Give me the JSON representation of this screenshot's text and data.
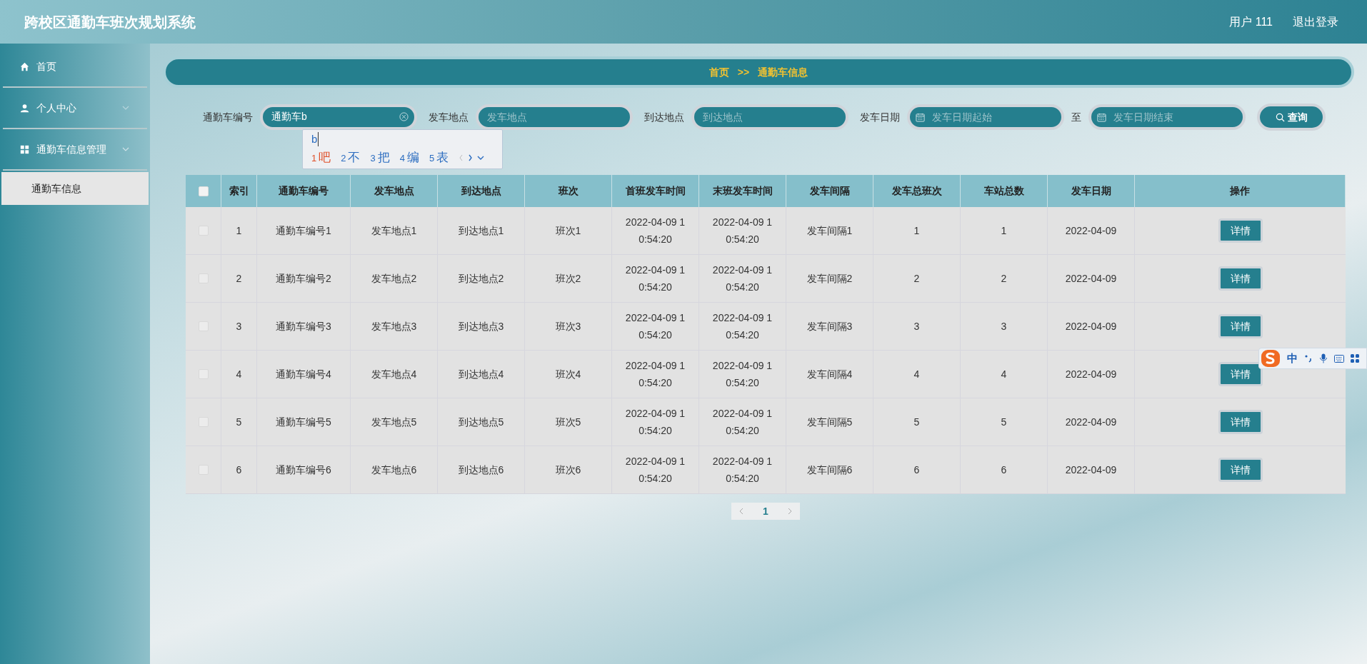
{
  "header": {
    "title": "跨校区通勤车班次规划系统",
    "user": "用户 111",
    "logout": "退出登录"
  },
  "sidebar": {
    "items": [
      {
        "label": "首页",
        "selected": false
      },
      {
        "label": "个人中心",
        "selected": false,
        "expanded": false
      },
      {
        "label": "通勤车信息管理",
        "selected": false,
        "expanded": true,
        "children": [
          {
            "label": "通勤车信息",
            "selected": true
          }
        ]
      }
    ]
  },
  "breadcrumb": {
    "home": "首页",
    "separator": ">>",
    "current": "通勤车信息"
  },
  "search": {
    "fields": [
      {
        "label": "通勤车编号",
        "value": "通勤车b",
        "clearable": true
      },
      {
        "label": "发车地点",
        "placeholder": "发车地点"
      },
      {
        "label": "到达地点",
        "placeholder": "到达地点"
      }
    ],
    "date": {
      "label": "发车日期",
      "start_placeholder": "发车日期起始",
      "to": "至",
      "end_placeholder": "发车日期结束"
    },
    "button": "查询"
  },
  "ime_popup": {
    "composition": "b",
    "candidates": [
      {
        "index": "1",
        "char": "吧",
        "selected": true
      },
      {
        "index": "2",
        "char": "不",
        "selected": false
      },
      {
        "index": "3",
        "char": "把",
        "selected": false
      },
      {
        "index": "4",
        "char": "编",
        "selected": false
      },
      {
        "index": "5",
        "char": "表",
        "selected": false
      }
    ]
  },
  "ime_toolbar": {
    "mode": "中"
  },
  "table": {
    "select_all_checked": false,
    "columns": [
      "索引",
      "通勤车编号",
      "发车地点",
      "到达地点",
      "班次",
      "首班发车时间",
      "末班发车时间",
      "发车间隔",
      "发车总班次",
      "车站总数",
      "发车日期",
      "操作"
    ],
    "rows": [
      {
        "checked": false,
        "cells": [
          "1",
          "通勤车编号1",
          "发车地点1",
          "到达地点1",
          "班次1",
          "2022-04-09 10:54:20",
          "2022-04-09 10:54:20",
          "发车间隔1",
          "1",
          "1",
          "2022-04-09"
        ],
        "action": "详情"
      },
      {
        "checked": false,
        "cells": [
          "2",
          "通勤车编号2",
          "发车地点2",
          "到达地点2",
          "班次2",
          "2022-04-09 10:54:20",
          "2022-04-09 10:54:20",
          "发车间隔2",
          "2",
          "2",
          "2022-04-09"
        ],
        "action": "详情"
      },
      {
        "checked": false,
        "cells": [
          "3",
          "通勤车编号3",
          "发车地点3",
          "到达地点3",
          "班次3",
          "2022-04-09 10:54:20",
          "2022-04-09 10:54:20",
          "发车间隔3",
          "3",
          "3",
          "2022-04-09"
        ],
        "action": "详情"
      },
      {
        "checked": false,
        "cells": [
          "4",
          "通勤车编号4",
          "发车地点4",
          "到达地点4",
          "班次4",
          "2022-04-09 10:54:20",
          "2022-04-09 10:54:20",
          "发车间隔4",
          "4",
          "4",
          "2022-04-09"
        ],
        "action": "详情"
      },
      {
        "checked": false,
        "cells": [
          "5",
          "通勤车编号5",
          "发车地点5",
          "到达地点5",
          "班次5",
          "2022-04-09 10:54:20",
          "2022-04-09 10:54:20",
          "发车间隔5",
          "5",
          "5",
          "2022-04-09"
        ],
        "action": "详情"
      },
      {
        "checked": false,
        "cells": [
          "6",
          "通勤车编号6",
          "发车地点6",
          "到达地点6",
          "班次6",
          "2022-04-09 10:54:20",
          "2022-04-09 10:54:20",
          "发车间隔6",
          "6",
          "6",
          "2022-04-09"
        ],
        "action": "详情"
      }
    ]
  },
  "pagination": {
    "pages": [
      {
        "label": "1",
        "selected": true
      }
    ]
  }
}
